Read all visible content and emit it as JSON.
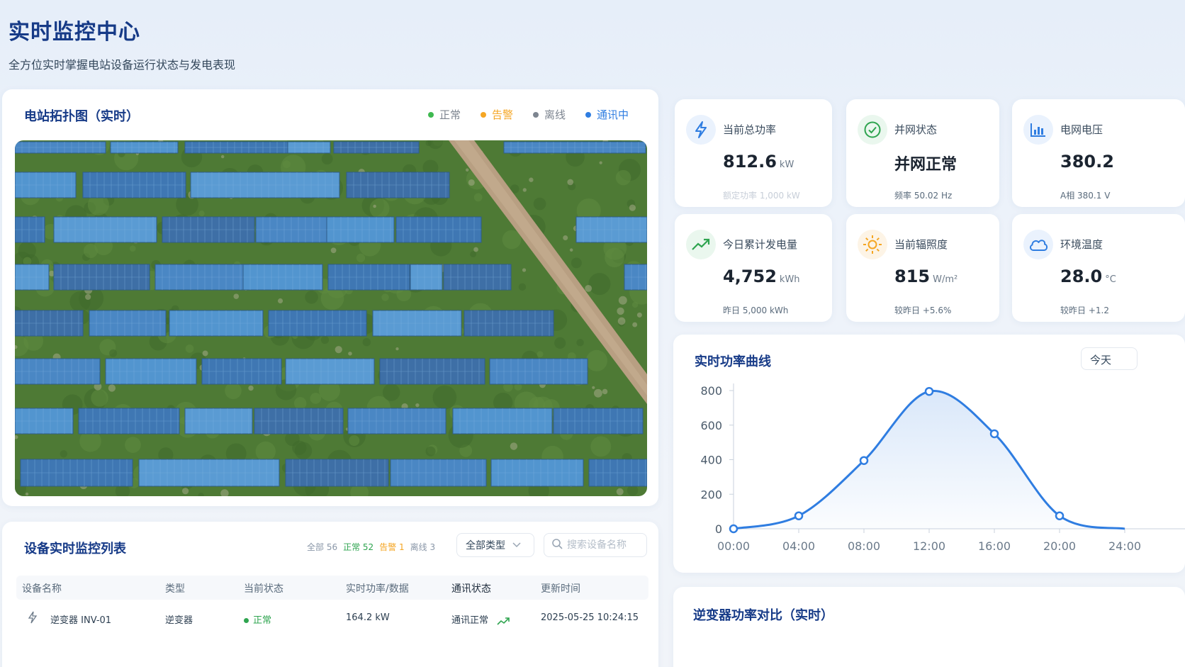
{
  "header": {
    "title": "实时监控中心",
    "subtitle": "全方位实时掌握电站设备运行状态与发电表现"
  },
  "topology": {
    "title": "电站拓扑图（实时）",
    "legend": [
      {
        "label": "正常",
        "color": "#3fb950"
      },
      {
        "label": "告警",
        "color": "#f5a623"
      },
      {
        "label": "离线",
        "color": "#7d8590"
      },
      {
        "label": "通讯中",
        "color": "#2f7de1"
      }
    ]
  },
  "kpis": [
    {
      "label": "当前总功率",
      "value": "812.6",
      "unit": "kW",
      "sub": "额定功率 1,000 kW",
      "icon": "bolt-icon",
      "color": "#2f7de1"
    },
    {
      "label": "并网状态",
      "value": "并网正常",
      "unit": "",
      "sub": "频率 50.02 Hz",
      "icon": "check-circle-icon",
      "color": "#2ea44f"
    },
    {
      "label": "电网电压",
      "value": "380.2",
      "unit": "",
      "sub": "A相 380.1 V",
      "icon": "bar-chart-icon",
      "color": "#2f7de1"
    },
    {
      "label": "今日累计发电量",
      "value": "4,752",
      "unit": "kWh",
      "sub": "昨日 5,000 kWh",
      "icon": "trend-up-icon",
      "color": "#2ea44f"
    },
    {
      "label": "当前辐照度",
      "value": "815",
      "unit": "W/m²",
      "sub": "较昨日 +5.6%",
      "icon": "sun-icon",
      "color": "#f5a623"
    },
    {
      "label": "环境温度",
      "value": "28.0",
      "unit": "°C",
      "sub": "较昨日 +1.2",
      "icon": "cloud-icon",
      "color": "#2f7de1"
    }
  ],
  "device_list": {
    "title": "设备实时监控列表",
    "counts": [
      {
        "label": "全部 56",
        "color": "#8a97a8"
      },
      {
        "label": "正常 52",
        "color": "#2ea44f"
      },
      {
        "label": "告警 1",
        "color": "#f5a623"
      },
      {
        "label": "离线 3",
        "color": "#8a97a8"
      }
    ],
    "type_filter": "全部类型",
    "search_placeholder": "搜索设备名称",
    "columns": [
      "设备名称",
      "类型",
      "当前状态",
      "实时功率/数据",
      "通讯状态",
      "更新时间"
    ],
    "rows": [
      {
        "name": "逆变器 INV-01",
        "type": "逆变器",
        "status": "正常",
        "power": "164.2 kW",
        "comm": "通讯正常",
        "updated": "2025-05-25 10:24:15"
      }
    ]
  },
  "power_curve": {
    "title": "实时功率曲线",
    "range_button": "今天"
  },
  "inverter_compare": {
    "title": "逆变器功率对比（实时）"
  },
  "chart_data": {
    "type": "line",
    "title": "实时功率曲线",
    "x": [
      "00:00",
      "04:00",
      "08:00",
      "12:00",
      "16:00",
      "20:00",
      "24:00"
    ],
    "series": [
      {
        "values": [
          0,
          75,
          395,
          795,
          550,
          75,
          0
        ]
      }
    ],
    "yticks": [
      0,
      200,
      400,
      600,
      800
    ],
    "ylim": [
      0,
      800
    ],
    "color": "#2f7de1"
  }
}
